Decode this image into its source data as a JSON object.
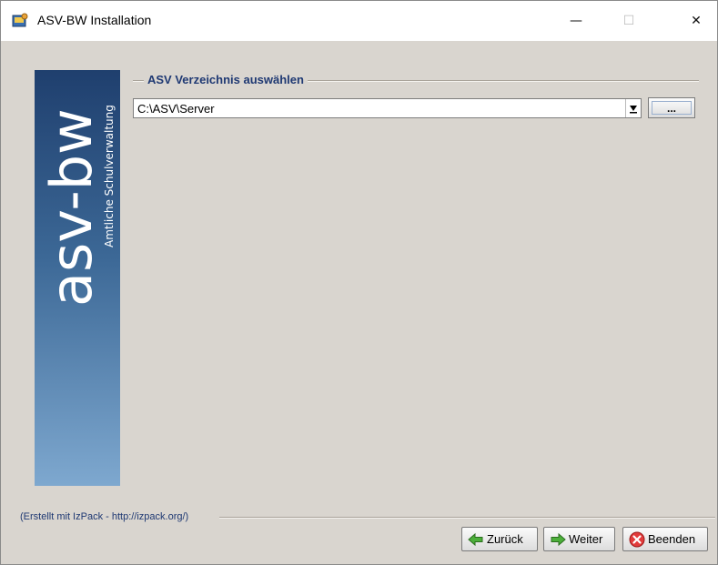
{
  "window": {
    "title": "ASV-BW Installation",
    "controls": {
      "minimize": "—",
      "maximize": "☐",
      "close": "✕"
    }
  },
  "banner": {
    "logo_text": "asv-bw",
    "subtitle": "Amtliche Schulverwaltung"
  },
  "section": {
    "title": "ASV Verzeichnis auswählen"
  },
  "directory": {
    "value": "C:\\ASV\\Server",
    "browse_label": "..."
  },
  "footer": {
    "credit": "(Erstellt mit IzPack - http://izpack.org/)"
  },
  "buttons": {
    "back": "Zurück",
    "next": "Weiter",
    "quit": "Beenden"
  },
  "colors": {
    "window_bg": "#d9d5cf",
    "section_title": "#1f3973",
    "banner_top": "#1f3f6e",
    "banner_bottom": "#7ea8cf"
  }
}
